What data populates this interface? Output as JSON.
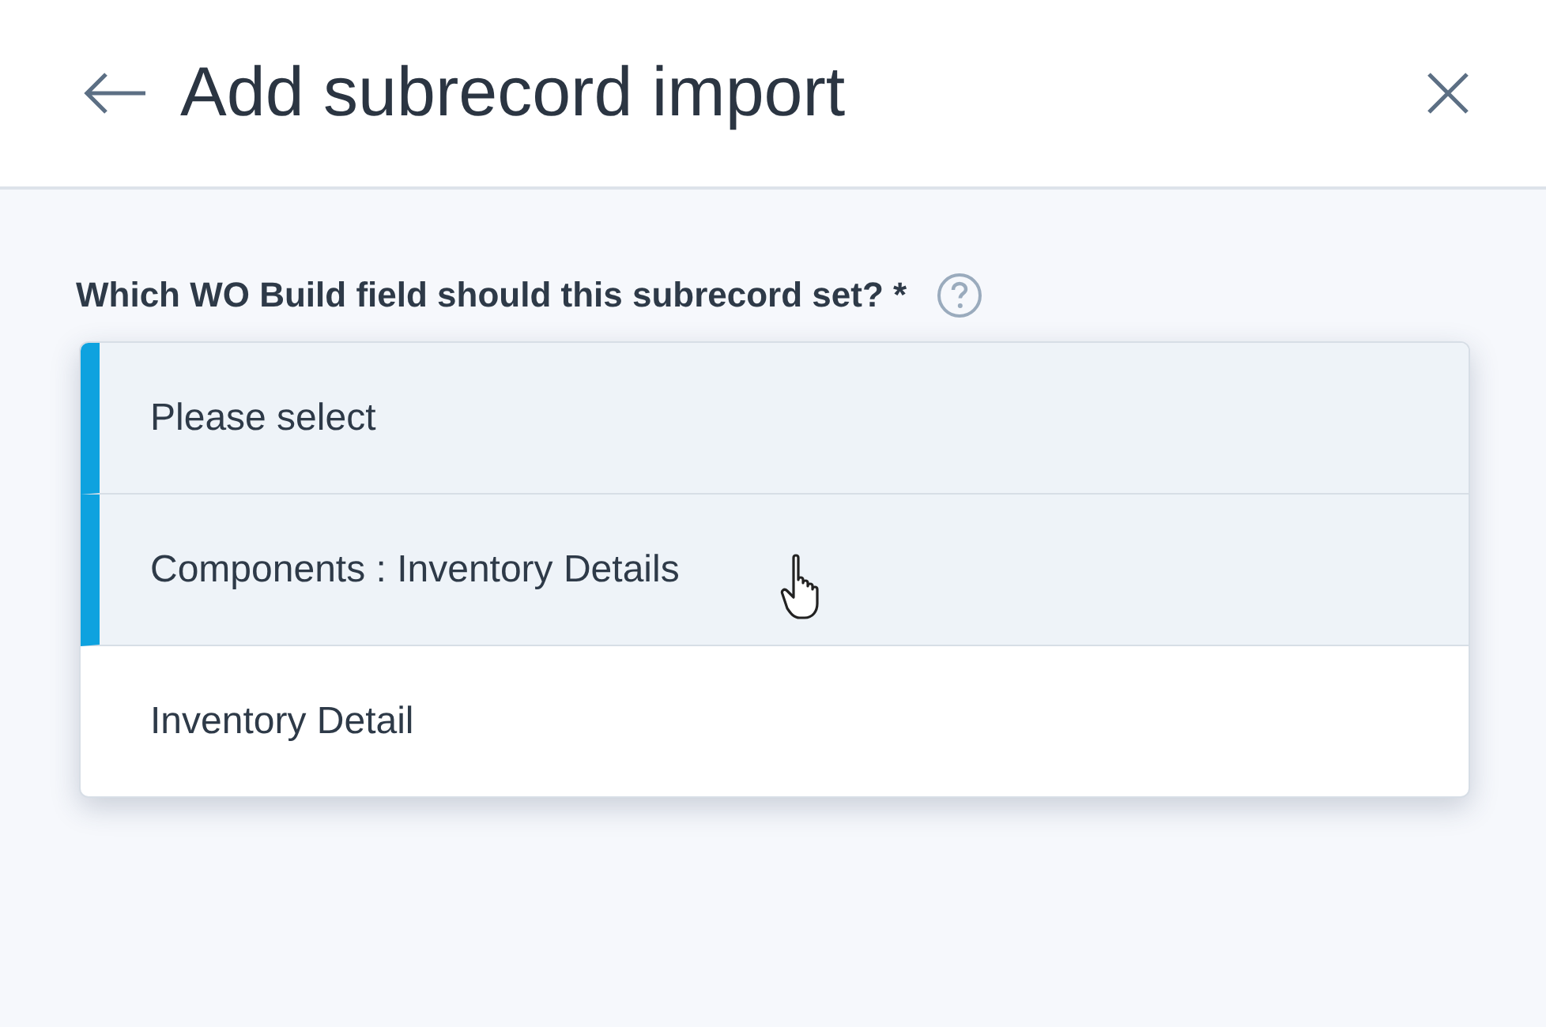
{
  "header": {
    "title": "Add subrecord import"
  },
  "field": {
    "label": "Which WO Build field should this subrecord set? *"
  },
  "options": [
    {
      "label": "Please select",
      "highlighted": true,
      "hovered": false
    },
    {
      "label": "Components : Inventory Details",
      "highlighted": true,
      "hovered": true
    },
    {
      "label": "Inventory Detail",
      "highlighted": false,
      "hovered": false
    }
  ]
}
